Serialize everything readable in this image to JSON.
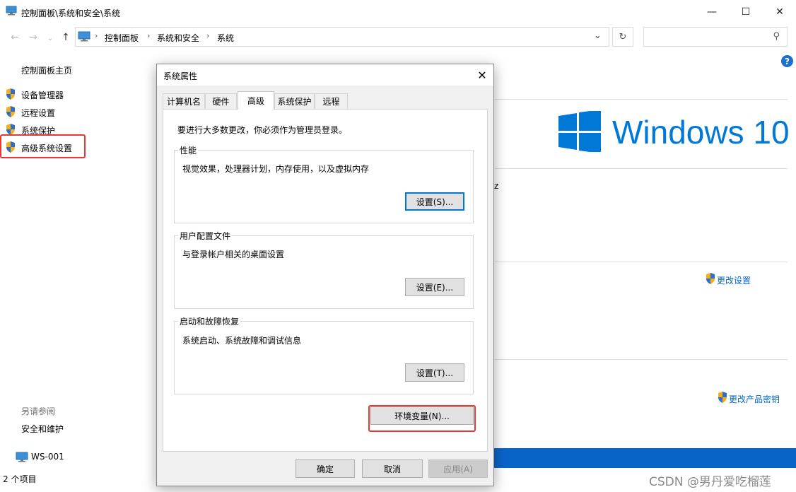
{
  "window": {
    "title": "控制面板\\系统和安全\\系统",
    "controls": {
      "minimize": "—",
      "maximize": "☐",
      "close": "✕"
    }
  },
  "address": {
    "crumbs": [
      "控制面板",
      "系统和安全",
      "系统"
    ],
    "separator": "›",
    "refresh_glyph": "↻",
    "dropdown_glyph": "⌄",
    "search_glyph": "⚲",
    "nav": {
      "back": "←",
      "forward": "→",
      "recent": "⌄",
      "up": "↑"
    }
  },
  "help_glyph": "?",
  "left_pane": {
    "home": "控制面板主页",
    "links": [
      "设备管理器",
      "远程设置",
      "系统保护",
      "高级系统设置"
    ],
    "see_also_title": "另请参阅",
    "see_also_links": [
      "安全和维护"
    ]
  },
  "right_pane": {
    "logo_text": "Windows 10",
    "partial_text": "z",
    "change_settings": "更改设置",
    "change_product_key": "更改产品密钥"
  },
  "network": {
    "computer": "WS-001"
  },
  "status_bar": {
    "item_count": "2 个项目"
  },
  "dialog": {
    "title": "系统属性",
    "close_glyph": "✕",
    "tabs": [
      "计算机名",
      "硬件",
      "高级",
      "系统保护",
      "远程"
    ],
    "active_tab": "高级",
    "admin_note": "要进行大多数更改，你必须作为管理员登录。",
    "groups": [
      {
        "label": "性能",
        "desc": "视觉效果，处理器计划，内存使用，以及虚拟内存",
        "button": "设置(S)..."
      },
      {
        "label": "用户配置文件",
        "desc": "与登录帐户相关的桌面设置",
        "button": "设置(E)..."
      },
      {
        "label": "启动和故障恢复",
        "desc": "系统启动、系统故障和调试信息",
        "button": "设置(T)..."
      }
    ],
    "env_button": "环境变量(N)...",
    "ok": "确定",
    "cancel": "取消",
    "apply": "应用(A)"
  },
  "watermark": "CSDN @男丹爱吃榴莲",
  "colors": {
    "accent": "#0078d7",
    "highlight": "#e53935",
    "taskbar_blue": "#0a64c8"
  }
}
